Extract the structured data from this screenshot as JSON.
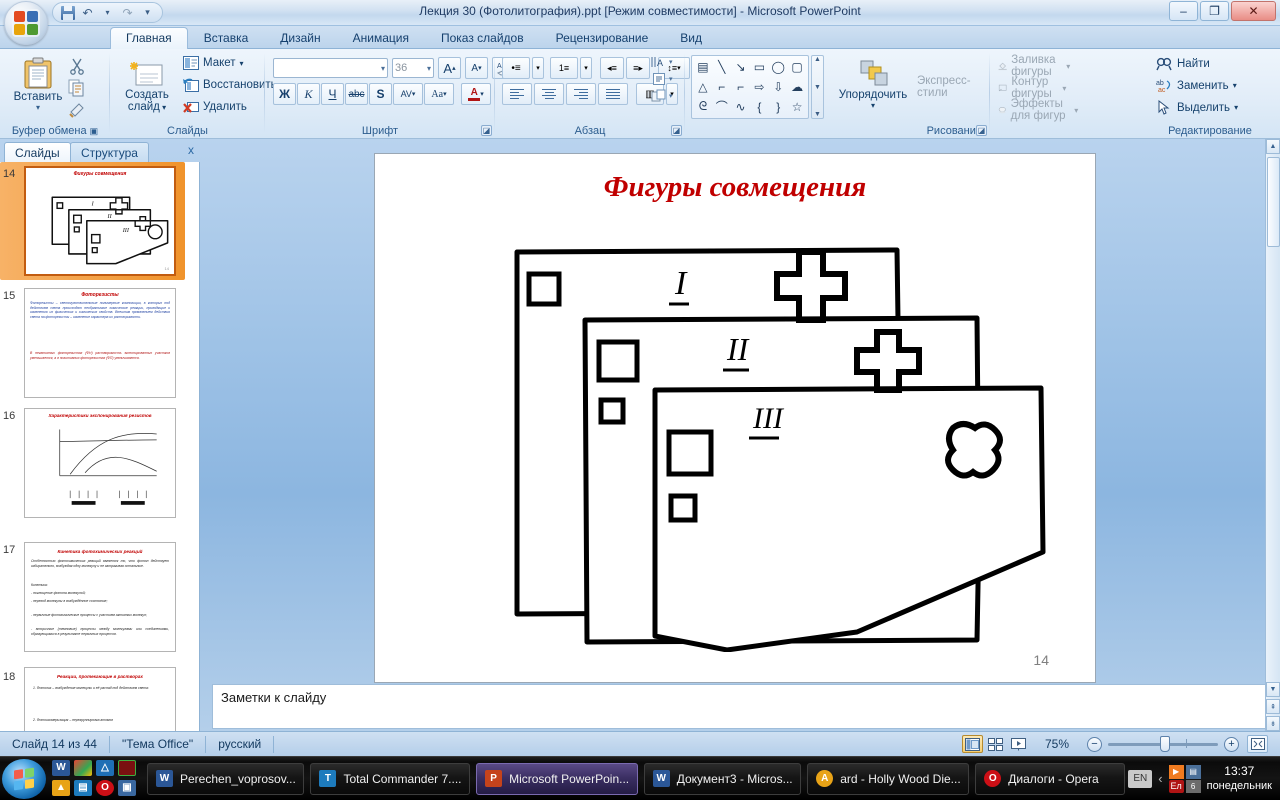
{
  "window": {
    "title": "Лекция 30 (Фотолитография).ppt [Режим совместимости] - Microsoft PowerPoint",
    "minimize": "–",
    "maximize": "❐",
    "close": "✕"
  },
  "qat": {
    "save": "save-icon",
    "undo": "↶",
    "undo_arrow": "▾",
    "redo": "↷",
    "more": "▾"
  },
  "tabs": [
    {
      "label": "Главная",
      "active": true
    },
    {
      "label": "Вставка",
      "active": false
    },
    {
      "label": "Дизайн",
      "active": false
    },
    {
      "label": "Анимация",
      "active": false
    },
    {
      "label": "Показ слайдов",
      "active": false
    },
    {
      "label": "Рецензирование",
      "active": false
    },
    {
      "label": "Вид",
      "active": false
    }
  ],
  "ribbon": {
    "clipboard": {
      "label": "Буфер обмена",
      "paste": "Вставить",
      "paste_arrow": "▾",
      "cut": "cut-icon",
      "copy": "copy-icon",
      "format_painter": "format-painter-icon"
    },
    "slides": {
      "label": "Слайды",
      "new_slide_line1": "Создать",
      "new_slide_line2": "слайд",
      "new_slide_arrow": "▾",
      "layout": "Макет",
      "layout_arrow": "▾",
      "reset": "Восстановить",
      "delete": "Удалить"
    },
    "font": {
      "label": "Шрифт",
      "font_name_value": "",
      "font_size_value": "36",
      "grow": "A",
      "shrink": "A",
      "clear_formatting": "Aa",
      "bold": "Ж",
      "italic": "К",
      "underline": "Ч",
      "strikethrough": "abc",
      "shadow": "S",
      "spacing": "AV",
      "change_case": "Aa",
      "font_color": "A"
    },
    "paragraph": {
      "label": "Абзац",
      "bullets": "•≡",
      "numbering": "1≡",
      "decrease_indent": "◂≡",
      "increase_indent": "≡▸",
      "line_spacing": "↕≡",
      "align_left": "align-left",
      "align_center": "align-center",
      "align_right": "align-right",
      "justify": "justify",
      "columns": "▥",
      "text_direction": "text-direction",
      "align_text": "align-text",
      "smart_art": "smart-art"
    },
    "drawing": {
      "label": "Рисование",
      "arrange": "Упорядочить",
      "arrange_arrow": "▾",
      "quick_styles": "Экспресс-стили",
      "shape_fill": "Заливка фигуры",
      "shape_outline": "Контур фигуры",
      "shape_effects": "Эффекты для фигур",
      "menu_arrow": "▾",
      "shapes": [
        "▤",
        "╲",
        "↘",
        "▭",
        "◯",
        "▢",
        "△",
        "⌐",
        "⌐",
        "⇨",
        "⇩",
        "☁",
        "ᘓ",
        "⌒",
        "∿",
        "{",
        "}",
        "☆"
      ],
      "scroll_up": "▲",
      "scroll_down": "▼",
      "scroll_more": "▼"
    },
    "editing": {
      "label": "Редактирование",
      "find": "Найти",
      "replace": "Заменить",
      "select": "Выделить",
      "menu_arrow": "▾"
    }
  },
  "panel": {
    "tab_slides": "Слайды",
    "tab_outline": "Структура",
    "close": "x",
    "thumbnails": [
      {
        "num": "14",
        "title": "Фигуры совмещения",
        "selected": true,
        "kind": "figure"
      },
      {
        "num": "15",
        "title": "Фоторезисты",
        "selected": false,
        "kind": "text",
        "lines": [
          "Фоторезисты – светочувствительные полимерные композиции, в которых под действием света происходят необратимые химические реакции, приводящие к изменению их физических и химических свойств. Внешним проявлением действия света на фоторезисты – изменение характера их растворимости.",
          "В негативных фоторезистах (ФН) растворимость экспонированных участков уменьшается, а в позитивных фоторезистах (ФП) увеличивается."
        ]
      },
      {
        "num": "16",
        "title": "Характеристики экспонирования резистов",
        "selected": false,
        "kind": "chart"
      },
      {
        "num": "17",
        "title": "Кинетика фотохимических реакций",
        "selected": false,
        "kind": "text",
        "lines": [
          "Особенностью фотохимических реакций является то, что фотон действует избирательно, возбуждая одну молекулу и не затрагивая остальные.",
          "Кинетика:",
          "- поглощение фотона молекулой;",
          "- переход молекулы в возбуждённое состояние;",
          "- первичные фотохимические процессы с участием активных молекул;",
          "- вторичные (темновые) процессы между молекулами или соединениями, образующимися в результате первичных процессов."
        ]
      },
      {
        "num": "18",
        "title": "Реакции, протекающие в растворах",
        "selected": false,
        "kind": "text",
        "lines": [
          "1. Фотолиз – возбуждение молекулы и её распад под действием света:",
          "2. Фотоизомеризация – перегруппировка атомов"
        ]
      }
    ]
  },
  "slide": {
    "title": "Фигуры совмещения",
    "number": "14",
    "labels": {
      "one": "I",
      "two": "II",
      "three": "III"
    }
  },
  "notes": {
    "placeholder": "Заметки к слайду"
  },
  "status": {
    "slide_counter": "Слайд 14 из 44",
    "theme": "\"Тема Office\"",
    "language": "русский",
    "view_normal": "normal-view-icon",
    "view_sorter": "slide-sorter-icon",
    "view_show": "slideshow-icon",
    "zoom_value": "75%",
    "zoom_out": "−",
    "zoom_in": "+",
    "fit_window": "fit-to-window-icon"
  },
  "taskbar": {
    "start": "start-orb",
    "quicklaunch": [
      "W",
      "C",
      "A",
      "N",
      "A",
      "T",
      "O",
      "S"
    ],
    "buttons": [
      {
        "label": "Perechen_voprosov...",
        "icon": "W",
        "color": "#2b5797",
        "active": false
      },
      {
        "label": "Total Commander 7....",
        "icon": "T",
        "color": "#1d7bbd",
        "active": false
      },
      {
        "label": "Microsoft PowerPoin...",
        "icon": "P",
        "color": "#c5431c",
        "active": true
      },
      {
        "label": "Документ3 - Micros...",
        "icon": "W",
        "color": "#2b5797",
        "active": false
      },
      {
        "label": "ard - Holly Wood Die...",
        "icon": "A",
        "color": "#e8a317",
        "active": false
      },
      {
        "label": "Диалоги - Opera",
        "icon": "O",
        "color": "#cc0f16",
        "active": false
      }
    ],
    "tray": {
      "lang_en": "EN",
      "lang_ru": "Ел",
      "expand": "‹",
      "badge": "6",
      "time": "13:37",
      "day": "понедельник"
    }
  },
  "colors": {
    "title_red": "#c00000",
    "selected_orange": "#f0932b",
    "ribbon_blue": "#1a4b7c"
  }
}
